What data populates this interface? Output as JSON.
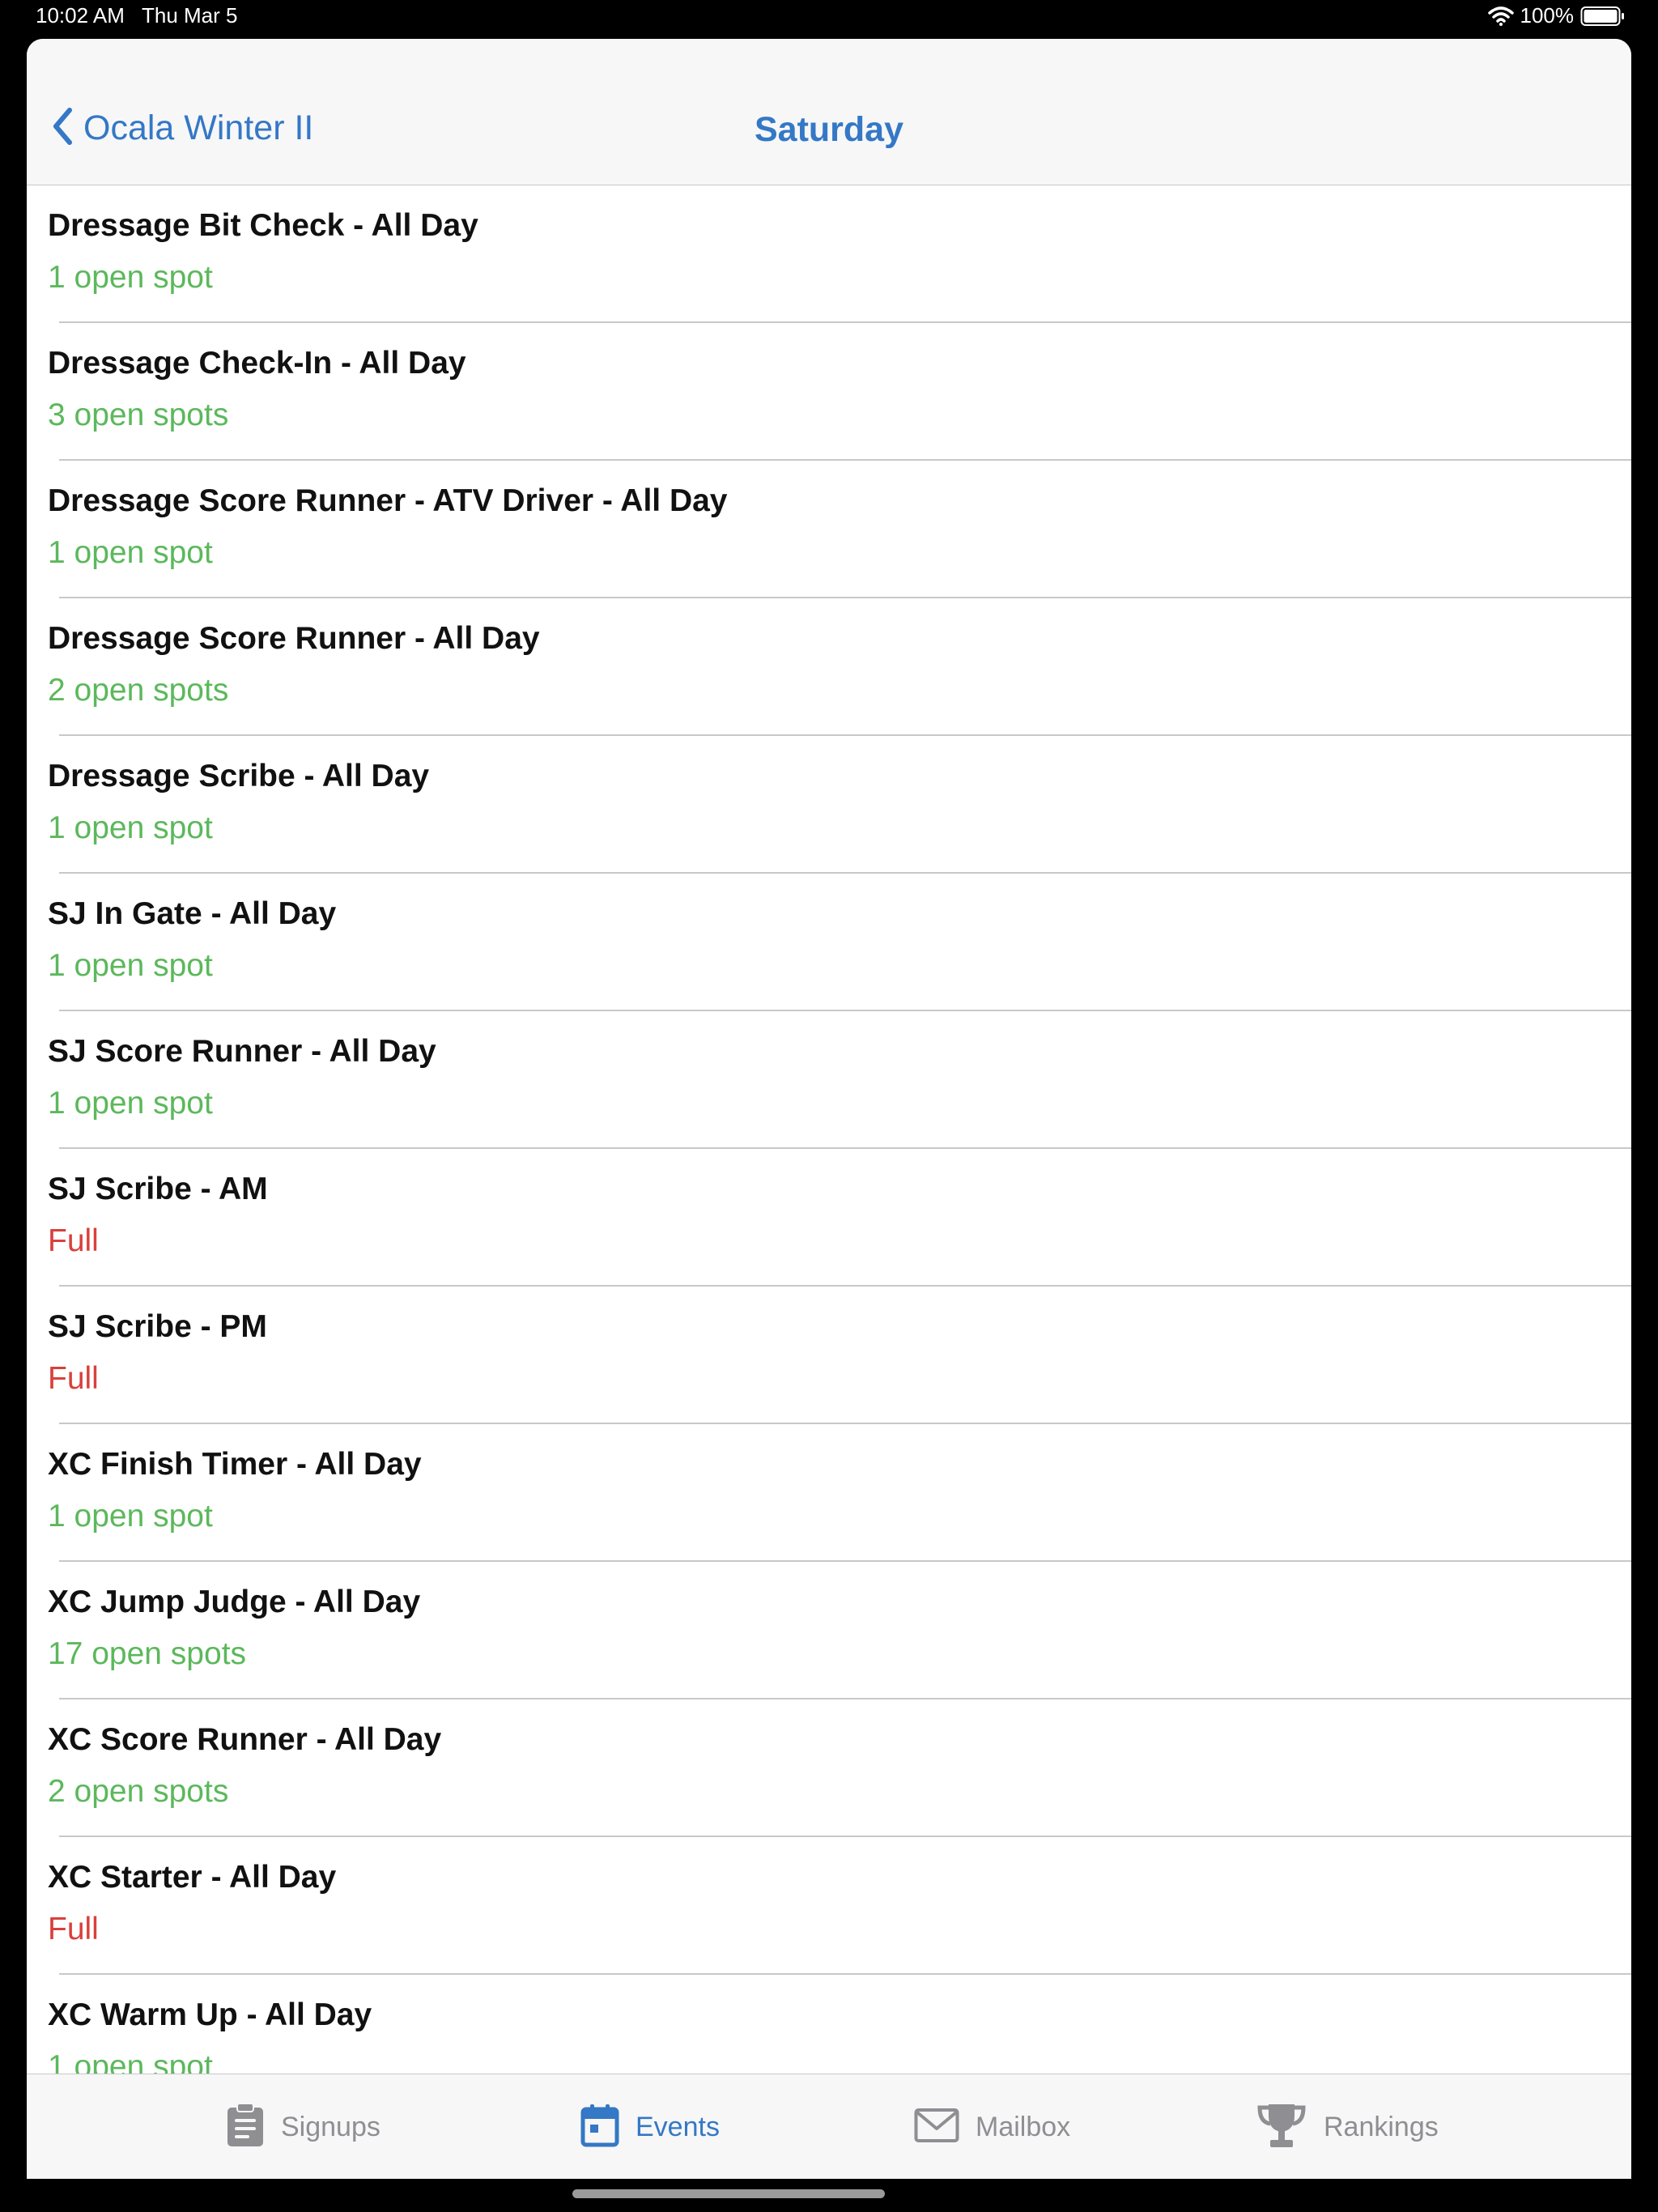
{
  "status_bar": {
    "time": "10:02 AM",
    "date": "Thu Mar 5",
    "battery": "100%"
  },
  "navbar": {
    "back_label": "Ocala Winter II",
    "title": "Saturday"
  },
  "events": [
    {
      "title": "Dressage Bit Check - All Day",
      "status": "1 open spot",
      "full": false
    },
    {
      "title": "Dressage Check-In - All Day",
      "status": "3 open spots",
      "full": false
    },
    {
      "title": "Dressage Score Runner - ATV Driver - All Day",
      "status": "1 open spot",
      "full": false
    },
    {
      "title": "Dressage Score Runner - All Day",
      "status": "2 open spots",
      "full": false
    },
    {
      "title": "Dressage Scribe - All Day",
      "status": "1 open spot",
      "full": false
    },
    {
      "title": "SJ In Gate - All Day",
      "status": "1 open spot",
      "full": false
    },
    {
      "title": "SJ Score Runner - All Day",
      "status": "1 open spot",
      "full": false
    },
    {
      "title": "SJ Scribe - AM",
      "status": "Full",
      "full": true
    },
    {
      "title": "SJ Scribe - PM",
      "status": "Full",
      "full": true
    },
    {
      "title": "XC Finish Timer - All Day",
      "status": "1 open spot",
      "full": false
    },
    {
      "title": "XC Jump Judge - All Day",
      "status": "17 open spots",
      "full": false
    },
    {
      "title": "XC Score Runner - All Day",
      "status": "2 open spots",
      "full": false
    },
    {
      "title": "XC Starter - All Day",
      "status": "Full",
      "full": true
    },
    {
      "title": "XC Warm Up - All Day",
      "status": "1 open spot",
      "full": false
    }
  ],
  "tabs": [
    {
      "label": "Signups",
      "icon": "clipboard-icon",
      "active": false
    },
    {
      "label": "Events",
      "icon": "calendar-icon",
      "active": true
    },
    {
      "label": "Mailbox",
      "icon": "envelope-icon",
      "active": false
    },
    {
      "label": "Rankings",
      "icon": "trophy-icon",
      "active": false
    }
  ],
  "colors": {
    "accent": "#3478c6",
    "open": "#5cb85c",
    "full": "#d9403a",
    "inactive": "#8e8e93"
  }
}
